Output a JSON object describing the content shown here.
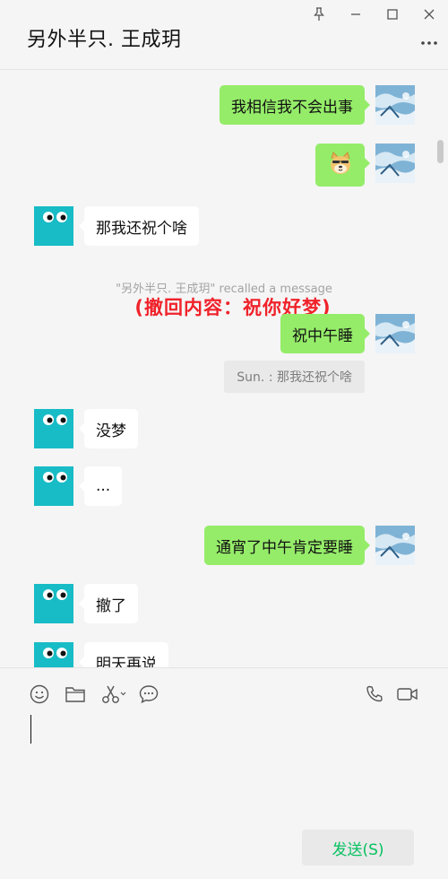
{
  "window": {
    "title": "另外半只. 王成玥",
    "pin_icon": "pin-icon",
    "minimize_icon": "minimize-icon",
    "maximize_icon": "maximize-icon",
    "close_icon": "close-icon",
    "more_icon": "more-options-icon"
  },
  "messages": [
    {
      "from": "me",
      "type": "text",
      "text": "我相信我不会出事"
    },
    {
      "from": "me",
      "type": "sticker",
      "sticker": "doge-sticker"
    },
    {
      "from": "friend",
      "type": "text",
      "text": "那我还祝个啥"
    },
    {
      "type": "system",
      "text": "\"另外半只. 王成玥\" recalled a message"
    },
    {
      "type": "annotation",
      "text": "(撤回内容：祝你好梦)"
    },
    {
      "from": "me",
      "type": "text",
      "text": "祝中午睡"
    },
    {
      "type": "quote",
      "text": "Sun. : 那我还祝个啥"
    },
    {
      "from": "friend",
      "type": "text",
      "text": "没梦"
    },
    {
      "from": "friend",
      "type": "text",
      "text": "..."
    },
    {
      "from": "me",
      "type": "text",
      "text": "通宵了中午肯定要睡"
    },
    {
      "from": "friend",
      "type": "text",
      "text": "撤了"
    },
    {
      "from": "friend",
      "type": "text",
      "text": "明天再说"
    }
  ],
  "toolbar": {
    "icons": [
      "emoji-icon",
      "folder-icon",
      "scissors-icon",
      "chat-history-icon",
      "voice-call-icon",
      "video-call-icon"
    ]
  },
  "input": {
    "value": "",
    "placeholder": ""
  },
  "send_button": {
    "label": "发送(S)"
  },
  "colors": {
    "background": "#f5f5f5",
    "my_bubble": "#95ec69",
    "friend_bubble": "#ffffff",
    "friend_avatar": "#18bcc6",
    "annotation": "#f0222a",
    "send_text": "#07c160"
  }
}
